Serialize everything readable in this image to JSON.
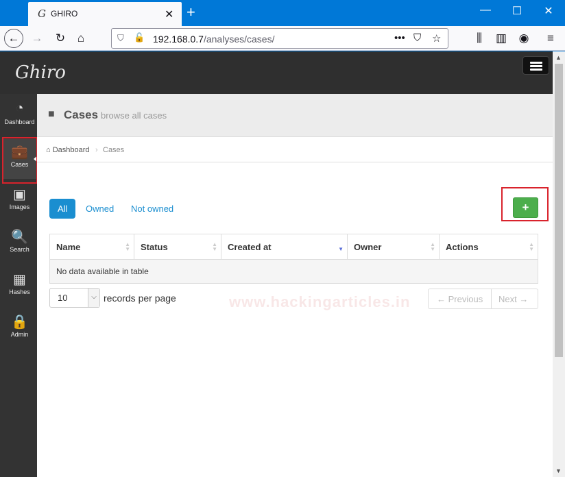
{
  "browser": {
    "tab_title": "GHIRO",
    "tab_icon_glyph": "G",
    "url_host": "192.168.0.7",
    "url_path": "/analyses/cases/",
    "new_tab_glyph": "+",
    "close_glyph": "✕",
    "minimize_glyph": "—",
    "maximize_glyph": "☐"
  },
  "app": {
    "logo": "Ghiro"
  },
  "sidebar": {
    "items": [
      {
        "label": "Dashboard",
        "icon": "dashboard-icon",
        "glyph": "◔"
      },
      {
        "label": "Cases",
        "icon": "briefcase-icon",
        "glyph": "💼"
      },
      {
        "label": "Images",
        "icon": "picture-icon",
        "glyph": "▣"
      },
      {
        "label": "Search",
        "icon": "search-icon",
        "glyph": "🔍"
      },
      {
        "label": "Hashes",
        "icon": "table-icon",
        "glyph": "▦"
      },
      {
        "label": "Admin",
        "icon": "lock-icon",
        "glyph": "🔒"
      }
    ],
    "active": "Cases"
  },
  "header": {
    "title": "Cases",
    "subtitle": "browse all cases"
  },
  "breadcrumb": {
    "home": "Dashboard",
    "current": "Cases"
  },
  "filters": {
    "all": "All",
    "owned": "Owned",
    "not_owned": "Not owned",
    "active": "All"
  },
  "add_button": {
    "glyph": "+"
  },
  "table": {
    "columns": [
      "Name",
      "Status",
      "Created at",
      "Owner",
      "Actions"
    ],
    "sorted_column": "Created at",
    "empty_message": "No data available in table"
  },
  "length_menu": {
    "value": "10",
    "suffix": "records per page"
  },
  "pagination": {
    "previous": "← Previous",
    "next": "Next →"
  },
  "watermark": "www.hackingarticles.in",
  "colors": {
    "accent": "#1a8ed0",
    "add_button": "#4cae4c",
    "highlight_box": "#d9232c",
    "topbar": "#2f2f2f",
    "sidebar": "#333333"
  }
}
